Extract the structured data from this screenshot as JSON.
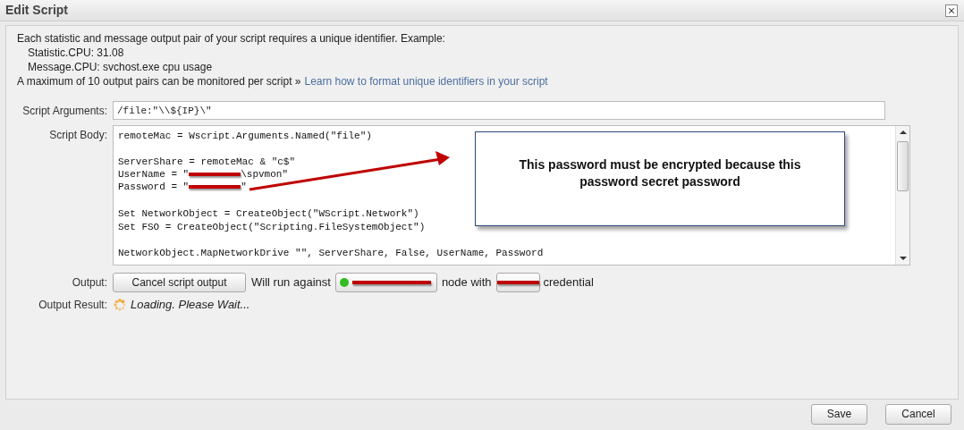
{
  "window": {
    "title": "Edit Script"
  },
  "intro": {
    "lines": [
      "Each statistic and message output pair of your script requires a unique identifier. Example:"
    ],
    "examples": [
      "Statistic.CPU: 31.08",
      "Message.CPU: svchost.exe cpu usage"
    ],
    "note": "A maximum of 10 output pairs can be monitored per script »",
    "link": "Learn how to format unique identifiers in your script"
  },
  "script_arguments": {
    "label": "Script Arguments:",
    "value": "/file:\"\\\\${IP}\\\""
  },
  "script_body": {
    "label": "Script Body:",
    "lines": [
      {
        "kind": "code",
        "text": "remoteMac = Wscript.Arguments.Named(\"file\")"
      },
      {
        "kind": "blank"
      },
      {
        "kind": "code",
        "text": "ServerShare = remoteMac & \"c$\""
      },
      {
        "kind": "redacted",
        "before": "UserName = \"",
        "after": "\\spvmon\""
      },
      {
        "kind": "redacted",
        "before": "Password = \"",
        "after": "\""
      },
      {
        "kind": "blank"
      },
      {
        "kind": "code",
        "text": "Set NetworkObject = CreateObject(\"WScript.Network\")"
      },
      {
        "kind": "code",
        "text": "Set FSO = CreateObject(\"Scripting.FileSystemObject\")"
      },
      {
        "kind": "blank"
      },
      {
        "kind": "code",
        "text": "NetworkObject.MapNetworkDrive \"\", ServerShare, False, UserName, Password"
      }
    ]
  },
  "callout": {
    "text": "This password must be encrypted because this password secret password"
  },
  "output": {
    "label": "Output:",
    "cancel_button": "Cancel script output",
    "run_text": "Will run against",
    "node_online": true,
    "node_text": "node with",
    "credential_text": "credential"
  },
  "output_result": {
    "label": "Output Result:",
    "status": "Loading. Please Wait..."
  },
  "buttons": [
    "Save",
    "Cancel"
  ]
}
